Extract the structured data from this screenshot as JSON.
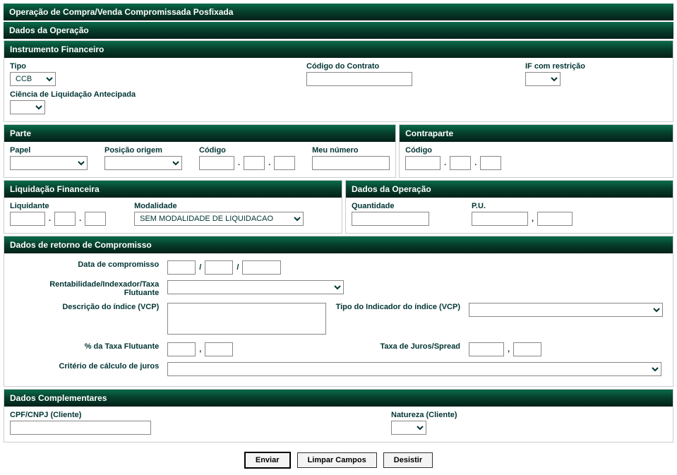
{
  "pageTitle": "Operação de Compra/Venda Compromissada Posfixada",
  "headers": {
    "dadosOperacao": "Dados da Operação",
    "instrumentoFinanceiro": "Instrumento Financeiro",
    "parte": "Parte",
    "contraparte": "Contraparte",
    "liquidacaoFinanceira": "Liquidação Financeira",
    "dadosOperacao2": "Dados da Operação",
    "dadosRetorno": "Dados de retorno de Compromisso",
    "dadosComplementares": "Dados Complementares"
  },
  "instrumento": {
    "tipoLabel": "Tipo",
    "tipoValue": "CCB",
    "codigoContratoLabel": "Código do Contrato",
    "codigoContratoValue": "",
    "ifRestricaoLabel": "IF com restrição",
    "ifRestricaoValue": "",
    "cienciaLabel": "Ciência de Liquidação Antecipada",
    "cienciaValue": ""
  },
  "parte": {
    "papelLabel": "Papel",
    "papelValue": "",
    "posicaoOrigemLabel": "Posição origem",
    "posicaoOrigemValue": "",
    "codigoLabel": "Código",
    "codigoSeg1": "",
    "codigoSeg2": "",
    "codigoSeg3": "",
    "meuNumeroLabel": "Meu número",
    "meuNumeroValue": ""
  },
  "contraparte": {
    "codigoLabel": "Código",
    "codigoSeg1": "",
    "codigoSeg2": "",
    "codigoSeg3": ""
  },
  "liquidacao": {
    "liquidanteLabel": "Liquidante",
    "liqSeg1": "",
    "liqSeg2": "",
    "liqSeg3": "",
    "modalidadeLabel": "Modalidade",
    "modalidadeValue": "SEM MODALIDADE DE LIQUIDACAO"
  },
  "dadosOp": {
    "quantidadeLabel": "Quantidade",
    "quantidadeValue": "",
    "puLabel": "P.U.",
    "puValue1": "",
    "puValue2": ""
  },
  "retorno": {
    "dataLabel": "Data de compromisso",
    "dataD": "",
    "dataM": "",
    "dataY": "",
    "rentabilidadeLabel": "Rentabilidade/Indexador/Taxa Flutuante",
    "rentabilidadeValue": "",
    "descricaoIndiceLabel": "Descrição do índice (VCP)",
    "descricaoIndiceValue": "",
    "tipoIndicadorLabel": "Tipo do Indicador do índice (VCP)",
    "tipoIndicadorValue": "",
    "pctTaxaLabel": "% da Taxa Flutuante",
    "pctTaxaV1": "",
    "pctTaxaV2": "",
    "taxaJurosLabel": "Taxa de Juros/Spread",
    "taxaJurosV1": "",
    "taxaJurosV2": "",
    "criterioLabel": "Critério de cálculo de juros",
    "criterioValue": ""
  },
  "complementares": {
    "cpfLabel": "CPF/CNPJ (Cliente)",
    "cpfValue": "",
    "naturezaLabel": "Natureza (Cliente)",
    "naturezaValue": ""
  },
  "buttons": {
    "enviar": "Enviar",
    "limpar": "Limpar Campos",
    "desistir": "Desistir"
  },
  "sep": {
    "slash": "/",
    "dot": ".",
    "comma": ","
  }
}
